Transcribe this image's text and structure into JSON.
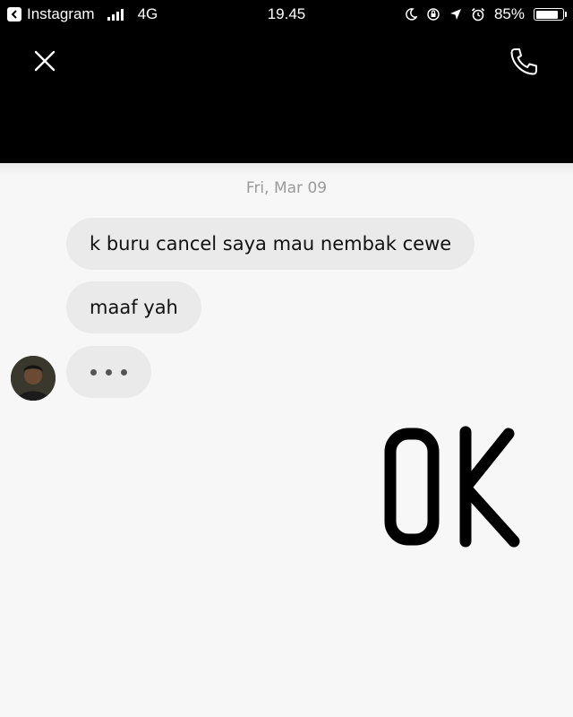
{
  "status_bar": {
    "back_app": "Instagram",
    "network": "4G",
    "time": "19.45",
    "battery_percent": "85%",
    "battery_level": 0.85
  },
  "header": {
    "close_icon": "close-icon",
    "call_icon": "phone-icon"
  },
  "chat": {
    "date": "Fri, Mar 09",
    "messages": [
      {
        "text": "k buru cancel saya mau nembak cewe"
      },
      {
        "text": "maaf yah"
      }
    ],
    "typing_indicator": "typing-dots",
    "sticker_text": "OK"
  },
  "colors": {
    "bar_background": "#000000",
    "bubble_background": "#eaeaea",
    "page_background": "#f7f7f7",
    "date_text": "#9a9a9a"
  }
}
